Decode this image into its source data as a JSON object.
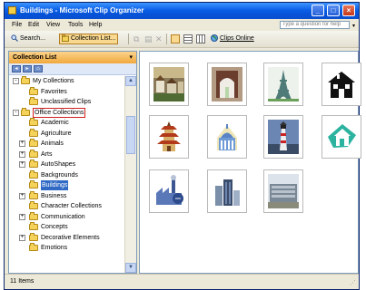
{
  "window": {
    "title": "Buildings - Microsoft Clip Organizer"
  },
  "menu": [
    "File",
    "Edit",
    "View",
    "Tools",
    "Help"
  ],
  "help_box": {
    "placeholder": "Type a question for help"
  },
  "toolbar": {
    "search_label": "Search...",
    "collection_list_label": "Collection List...",
    "clips_online_label": "Clips Online"
  },
  "collection_pane": {
    "title": "Collection List",
    "items": [
      {
        "label": "My Collections",
        "level": 1,
        "expander": "-"
      },
      {
        "label": "Favorites",
        "level": 2,
        "expander": ""
      },
      {
        "label": "Unclassified Clips",
        "level": 2,
        "expander": ""
      },
      {
        "label": "Office Collections",
        "level": 1,
        "expander": "-",
        "highlighted": true
      },
      {
        "label": "Academic",
        "level": 2,
        "expander": ""
      },
      {
        "label": "Agriculture",
        "level": 2,
        "expander": ""
      },
      {
        "label": "Animals",
        "level": 2,
        "expander": "+"
      },
      {
        "label": "Arts",
        "level": 2,
        "expander": "+"
      },
      {
        "label": "AutoShapes",
        "level": 2,
        "expander": "+"
      },
      {
        "label": "Backgrounds",
        "level": 2,
        "expander": ""
      },
      {
        "label": "Buildings",
        "level": 2,
        "expander": "",
        "selected": true
      },
      {
        "label": "Business",
        "level": 2,
        "expander": "+"
      },
      {
        "label": "Character Collections",
        "level": 2,
        "expander": ""
      },
      {
        "label": "Communication",
        "level": 2,
        "expander": "+"
      },
      {
        "label": "Concepts",
        "level": 2,
        "expander": ""
      },
      {
        "label": "Decorative Elements",
        "level": 2,
        "expander": "+"
      },
      {
        "label": "Emotions",
        "level": 2,
        "expander": ""
      }
    ]
  },
  "thumbnails": [
    {
      "name": "village-photo-thumb",
      "kind": "village"
    },
    {
      "name": "gate-photo-thumb",
      "kind": "gate"
    },
    {
      "name": "eiffel-tower-thumb",
      "kind": "eiffel"
    },
    {
      "name": "house-icon-thumb",
      "kind": "house"
    },
    {
      "name": "pagoda-thumb",
      "kind": "pagoda"
    },
    {
      "name": "capitol-dome-thumb",
      "kind": "dome"
    },
    {
      "name": "lighthouse-photo-thumb",
      "kind": "lighthouse"
    },
    {
      "name": "home-clipart-thumb",
      "kind": "home"
    },
    {
      "name": "factory-thumb",
      "kind": "factory"
    },
    {
      "name": "skyscrapers-thumb",
      "kind": "skyscrapers"
    },
    {
      "name": "office-building-photo-thumb",
      "kind": "office"
    }
  ],
  "status": {
    "text": "11 Items"
  },
  "colors": {
    "title_bar": "#0a5fe6",
    "pane_header": "#f1a83c",
    "selection": "#316ac5",
    "highlight_box": "#d21f1f"
  }
}
